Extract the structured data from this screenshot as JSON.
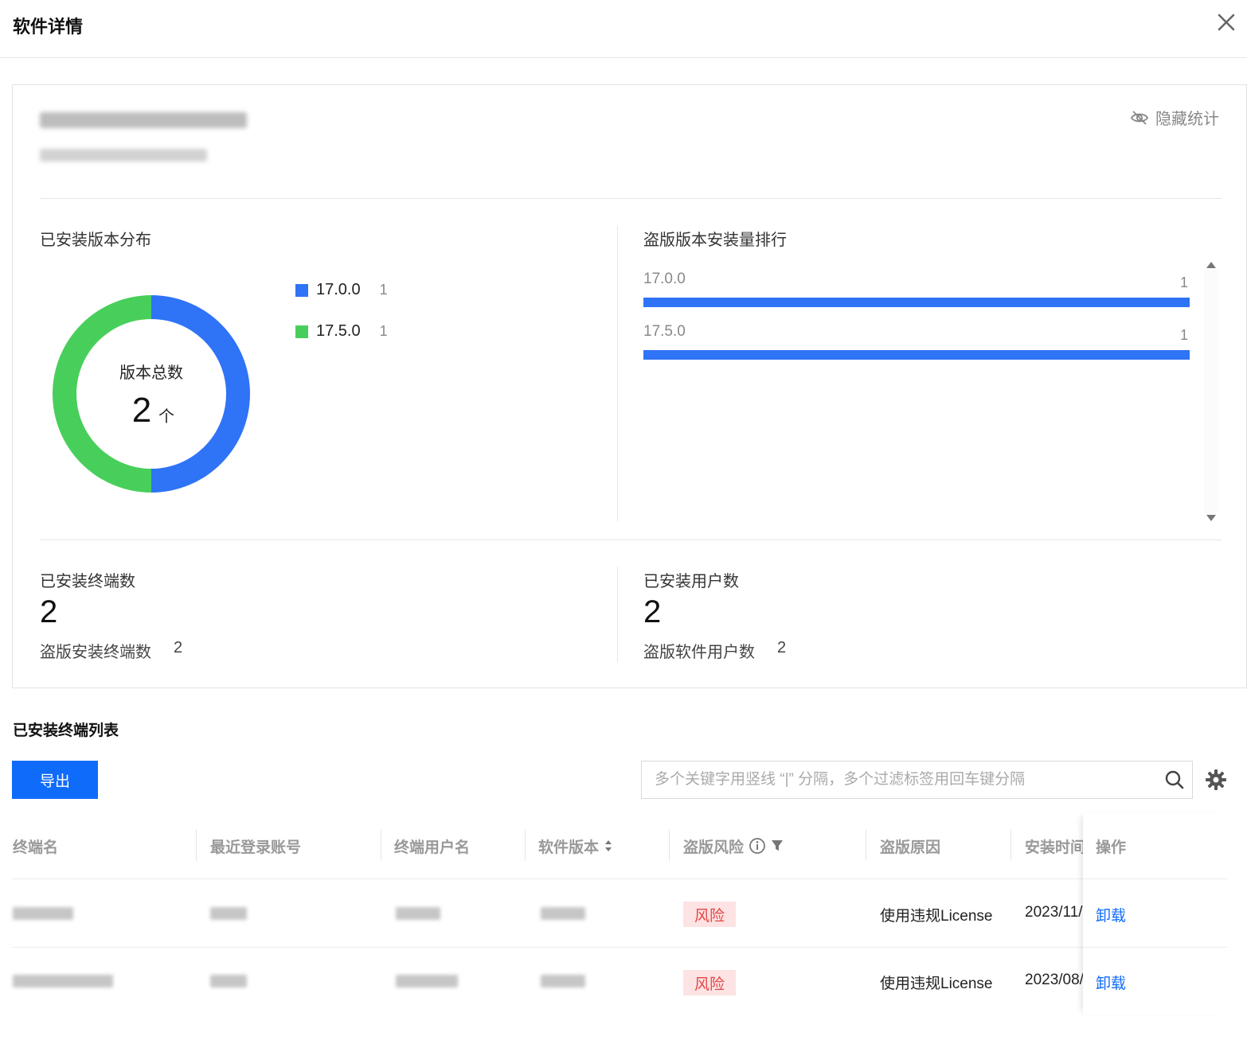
{
  "header": {
    "title": "软件详情"
  },
  "card": {
    "hide_stats_label": "隐藏统计",
    "version_dist": {
      "title": "已安装版本分布",
      "center_label": "版本总数",
      "center_value": "2",
      "center_unit": "个"
    },
    "piracy_rank": {
      "title": "盗版版本安装量排行"
    },
    "installed_terminals": {
      "label": "已安装终端数",
      "value": "2",
      "sub_label": "盗版安装终端数",
      "sub_value": "2"
    },
    "installed_users": {
      "label": "已安装用户数",
      "value": "2",
      "sub_label": "盗版软件用户数",
      "sub_value": "2"
    }
  },
  "chart_data": [
    {
      "type": "pie",
      "categories": [
        "17.0.0",
        "17.5.0"
      ],
      "values": [
        1,
        1
      ],
      "colors": [
        "#2f73f6",
        "#48cf5b"
      ]
    },
    {
      "type": "bar",
      "categories": [
        "17.0.0",
        "17.5.0"
      ],
      "values": [
        1,
        1
      ],
      "xlim": [
        0,
        1
      ],
      "colors": [
        "#2f73f6"
      ]
    }
  ],
  "list": {
    "title": "已安装终端列表",
    "export_label": "导出",
    "search_placeholder": "多个关键字用竖线 “|” 分隔，多个过滤标签用回车键分隔",
    "columns": [
      "终端名",
      "最近登录账号",
      "终端用户名",
      "软件版本",
      "盗版风险",
      "盗版原因",
      "安装时间",
      "操作"
    ],
    "rows": [
      {
        "risk": "风险",
        "reason": "使用违规License",
        "install_time": "2023/11/",
        "action": "卸载"
      },
      {
        "risk": "风险",
        "reason": "使用违规License",
        "install_time": "2023/08/",
        "action": "卸载"
      }
    ]
  },
  "icons": {
    "close": "close-icon",
    "hide": "eye-off-icon",
    "search": "search-icon",
    "settings": "gear-icon",
    "sort": "sort-icon",
    "info": "info-icon",
    "filter": "filter-icon"
  }
}
